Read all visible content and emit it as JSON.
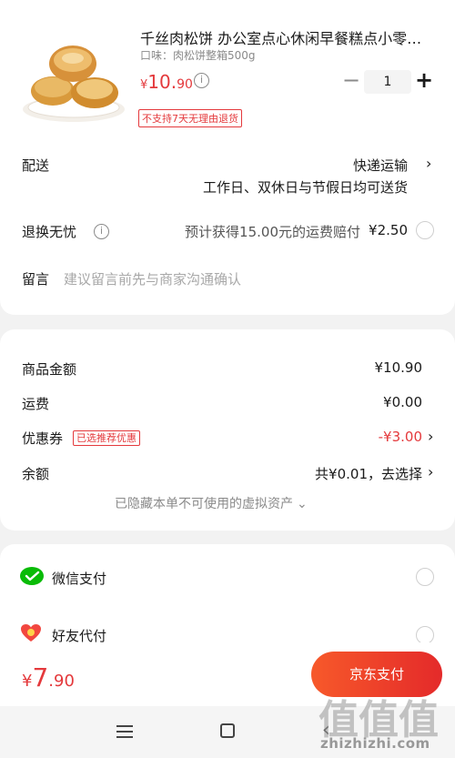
{
  "product": {
    "title": "千丝肉松饼 办公室点心休闲早餐糕点小零…",
    "spec": "口味：肉松饼整箱500g",
    "price_currency": "¥",
    "price_int": "10.",
    "price_dec": "90",
    "quantity": "1",
    "no_refund_tag": "不支持7天无理由退货"
  },
  "delivery": {
    "label": "配送",
    "method": "快递运输",
    "detail": "工作日、双休日与节假日均可送货"
  },
  "return_worry_free": {
    "label": "退换无忧",
    "desc": "预计获得15.00元的运费赔付",
    "price": "¥2.50"
  },
  "message": {
    "label": "留言",
    "placeholder": "建议留言前先与商家沟通确认"
  },
  "summary": {
    "goods_amount_label": "商品金额",
    "goods_amount": "¥10.90",
    "shipping_label": "运费",
    "shipping": "¥0.00",
    "coupon_label": "优惠券",
    "coupon_tag": "已选推荐优惠",
    "coupon_value": "-¥3.00",
    "balance_label": "余额",
    "balance_value": "共¥0.01，去选择",
    "hidden_assets": "已隐藏本单不可使用的虚拟资产"
  },
  "payment": {
    "wechat_label": "微信支付",
    "friend_label": "好友代付"
  },
  "footer": {
    "total_currency": "¥",
    "total_int": "7",
    "total_dec": ".90",
    "pay_button": "京东支付"
  },
  "watermark": {
    "text": "值",
    "site": "zhizhizhi.com"
  },
  "colors": {
    "accent": "#e4393c",
    "wechat": "#09bb07",
    "pay_gradient_start": "#f7592a",
    "pay_gradient_end": "#e42a2a"
  },
  "icons": [
    "info-icon",
    "chevron-right-icon",
    "chevron-down-icon",
    "wechat-pay-icon",
    "friend-pay-icon",
    "menu-icon",
    "home-icon",
    "back-icon"
  ]
}
